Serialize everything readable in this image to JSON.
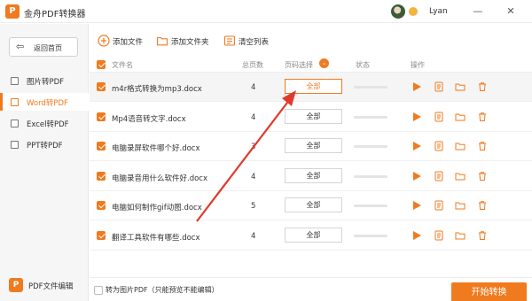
{
  "app": {
    "title": "金舟PDF转换器",
    "logo_letter": "P",
    "username": "Lyan"
  },
  "window": {
    "minimize": "—",
    "close": "✕"
  },
  "sidebar": {
    "back_label": "返回首页",
    "items": [
      {
        "label": "图片转PDF",
        "active": false
      },
      {
        "label": "Word转PDF",
        "active": true
      },
      {
        "label": "Excel转PDF",
        "active": false
      },
      {
        "label": "PPT转PDF",
        "active": false
      }
    ],
    "bottom_label": "PDF文件编辑"
  },
  "toolbar": {
    "add_file": "添加文件",
    "add_folder": "添加文件夹",
    "clear_list": "清空列表"
  },
  "table": {
    "columns": {
      "filename": "文件名",
      "pages": "总页数",
      "page_select": "页码选择",
      "status": "状态",
      "actions": "操作"
    },
    "rows": [
      {
        "filename": "m4r格式转换为mp3.docx",
        "pages": "4",
        "page_select": "全部"
      },
      {
        "filename": "Mp4语音转文字.docx",
        "pages": "4",
        "page_select": "全部"
      },
      {
        "filename": "电脑录屏软件哪个好.docx",
        "pages": "3",
        "page_select": "全部"
      },
      {
        "filename": "电脑录音用什么软件好.docx",
        "pages": "4",
        "page_select": "全部"
      },
      {
        "filename": "电脑如何制作gif动图.docx",
        "pages": "5",
        "page_select": "全部"
      },
      {
        "filename": "翻译工具软件有哪些.docx",
        "pages": "4",
        "page_select": "全部"
      }
    ]
  },
  "footer": {
    "convert_to_image_label": "转为图片PDF（只能预览不能编辑）",
    "start_button": "开始转换"
  },
  "colors": {
    "accent": "#f07a1e",
    "arrow": "#e03a2c"
  }
}
